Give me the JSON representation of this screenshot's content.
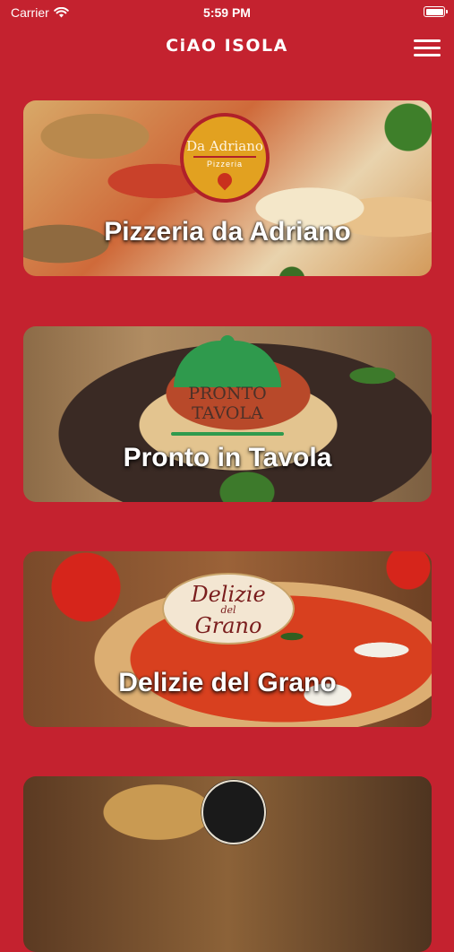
{
  "status_bar": {
    "carrier": "Carrier",
    "time": "5:59 PM"
  },
  "header": {
    "title": "CiAO ISOLA",
    "menu_icon": "hamburger-menu-icon"
  },
  "restaurants": [
    {
      "name": "Pizzeria da Adriano",
      "logo": {
        "title": "Da Adriano",
        "subtitle": "Pizzeria"
      }
    },
    {
      "name": "Pronto in Tavola",
      "logo": {
        "line1": "PRONTO",
        "line2": "TAVOLA"
      }
    },
    {
      "name": "Delizie del Grano",
      "logo": {
        "line1": "Delizie",
        "line2": "del",
        "line3": "Grano"
      }
    },
    {
      "name": ""
    }
  ],
  "colors": {
    "background": "#c4222f",
    "text": "#ffffff"
  }
}
